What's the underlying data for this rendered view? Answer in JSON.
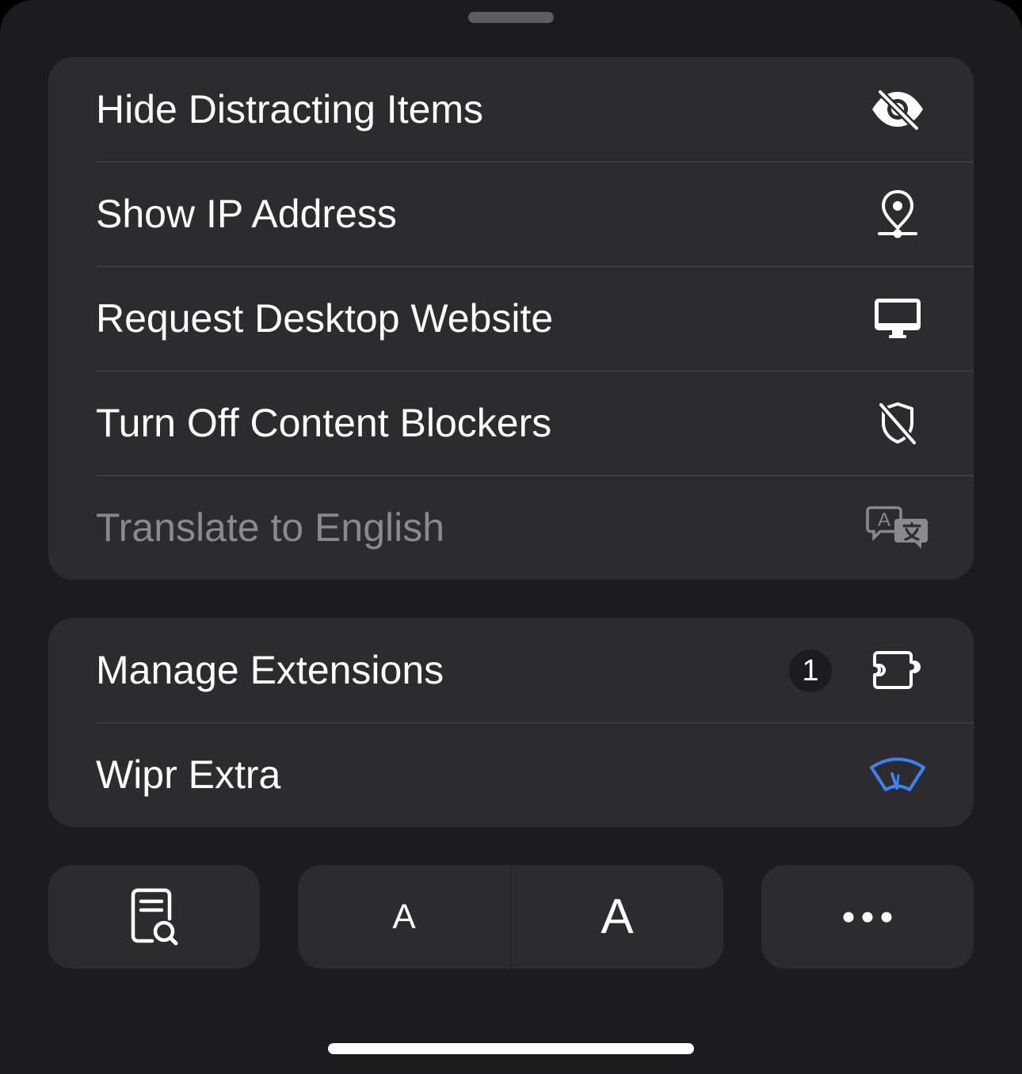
{
  "menu_group_1": {
    "items": [
      {
        "label": "Hide Distracting Items",
        "icon": "eye-slash-icon",
        "enabled": true
      },
      {
        "label": "Show IP Address",
        "icon": "location-pin-icon",
        "enabled": true
      },
      {
        "label": "Request Desktop Website",
        "icon": "desktop-computer-icon",
        "enabled": true
      },
      {
        "label": "Turn Off Content Blockers",
        "icon": "shield-slash-icon",
        "enabled": true
      },
      {
        "label": "Translate to English",
        "icon": "translate-icon",
        "enabled": false
      }
    ]
  },
  "menu_group_2": {
    "items": [
      {
        "label": "Manage Extensions",
        "icon": "puzzle-piece-icon",
        "badge": "1"
      },
      {
        "label": "Wipr Extra",
        "icon": "wiper-icon",
        "icon_color": "#3b82f6"
      }
    ]
  },
  "toolbar": {
    "reader_icon": "page-search-icon",
    "text_smaller_label": "A",
    "text_larger_label": "A",
    "more_icon": "ellipsis-icon"
  },
  "colors": {
    "sheet_background": "#1c1c1e",
    "group_background": "#2c2c2e",
    "text_primary": "#ffffff",
    "text_disabled": "#8a8a8e",
    "accent": "#3b82f6"
  }
}
